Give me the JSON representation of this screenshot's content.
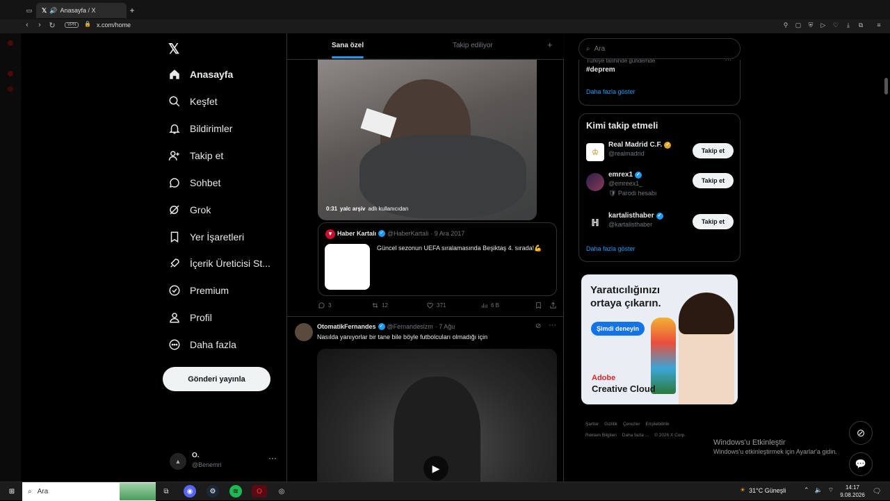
{
  "browser": {
    "tab_title": "Anasayfa / X",
    "url": "x.com/home",
    "vpn_label": "VPN"
  },
  "sidebar": {
    "items": [
      {
        "label": "Anasayfa",
        "icon": "home-icon",
        "active": true
      },
      {
        "label": "Keşfet",
        "icon": "search-icon"
      },
      {
        "label": "Bildirimler",
        "icon": "bell-icon"
      },
      {
        "label": "Takip et",
        "icon": "add-user-icon"
      },
      {
        "label": "Sohbet",
        "icon": "chat-icon"
      },
      {
        "label": "Grok",
        "icon": "grok-icon"
      },
      {
        "label": "Yer İşaretleri",
        "icon": "bookmark-icon"
      },
      {
        "label": "İçerik Üreticisi St...",
        "icon": "rocket-icon"
      },
      {
        "label": "Premium",
        "icon": "verified-icon"
      },
      {
        "label": "Profil",
        "icon": "person-icon"
      },
      {
        "label": "Daha fazla",
        "icon": "more-circle-icon"
      }
    ],
    "post_button": "Gönderi yayınla",
    "profile": {
      "name": "O.",
      "handle": "@Benemri"
    }
  },
  "feed": {
    "tabs": [
      "Sana özel",
      "Takip ediliyor"
    ],
    "tweet1": {
      "video_time": "0:31",
      "video_credit_user": "yalc arşiv",
      "video_credit_suffix": "adlı kullanıcıdan",
      "quote": {
        "author": "Haber Kartalı",
        "handle": "@HaberKartali",
        "date": "· 9 Ara 2017",
        "text": "Güncel sezonun UEFA sıralamasında Beşiktaş 4. sırada!💪"
      },
      "replies": "3",
      "retweets": "12",
      "likes": "371",
      "views": "6 B"
    },
    "tweet2": {
      "author": "OtomatikFernandes",
      "handle": "@Fernandeslzm",
      "date": "· 7 Ağu",
      "text": "Nasılda yanıyorlar bir tane bile böyle futbolcuları olmadığı için"
    }
  },
  "right": {
    "search_placeholder": "Ara",
    "trend": {
      "context": "Türkiye tarihinde gündemde",
      "name": "#deprem",
      "show_more": "Daha fazla göster"
    },
    "who_to_follow": {
      "title": "Kimi takip etmeli",
      "follow_label": "Takip et",
      "accounts": [
        {
          "name": "Real Madrid C.F.",
          "handle": "@realmadrid",
          "note": ""
        },
        {
          "name": "emrex1",
          "handle": "@emreex1_",
          "note": "🛡 Parodi hesabı"
        },
        {
          "name": "kartalisthaber",
          "handle": "@kartalisthaber",
          "note": ""
        }
      ],
      "show_more": "Daha fazla göster"
    },
    "ad": {
      "headline": "Yaratıcılığınızı ortaya çıkarın.",
      "cta": "Şimdi deneyin",
      "brand": "Adobe",
      "product": "Creative Cloud"
    },
    "footer": [
      "Şartlar",
      "Gizlilik",
      "Çerezler",
      "Erişilebilirlik",
      "Reklam Bilgileri",
      "Daha fazla ...",
      "© 2026 X Corp."
    ]
  },
  "watermark": {
    "title": "Windows'u Etkinleştir",
    "sub": "Windows'u etkinleştirmek için Ayarlar'a gidin."
  },
  "taskbar": {
    "search": "Ara",
    "weather": "31°C  Güneşli",
    "time": "14:17",
    "date": "9.08.2026"
  },
  "colors": {
    "accent": "#1d9bf0",
    "background": "#000000",
    "border": "#2f3336",
    "muted": "#71767b"
  }
}
